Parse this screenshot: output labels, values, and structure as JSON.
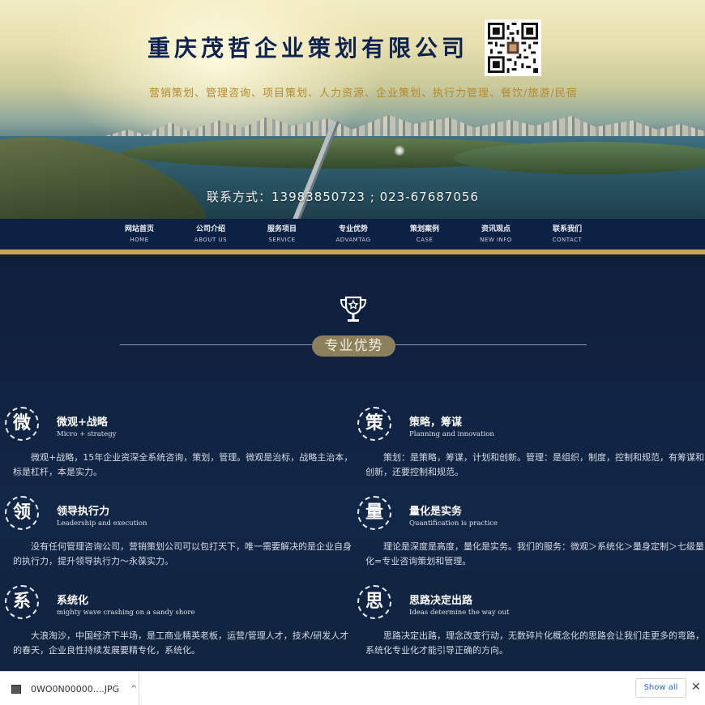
{
  "banner": {
    "company_title": "重庆茂哲企业策划有限公司",
    "services": "营销策划、管理咨询、项目策划、人力资源、企业策划、执行力管理、餐饮/旅游/民宿",
    "contact": "联系方式：13983850723 ; 023-67687056"
  },
  "nav": {
    "items": [
      {
        "cn": "网站首页",
        "en": "HOME"
      },
      {
        "cn": "公司介绍",
        "en": "ABOUT US"
      },
      {
        "cn": "服务项目",
        "en": "SERVICE"
      },
      {
        "cn": "专业优势",
        "en": "ADVAMTAG"
      },
      {
        "cn": "策划案例",
        "en": "CASE"
      },
      {
        "cn": "资讯观点",
        "en": "NEW INFO"
      },
      {
        "cn": "联系我们",
        "en": "CONTACT"
      }
    ]
  },
  "section": {
    "title": "专业优势",
    "icon": "trophy-icon"
  },
  "features": [
    {
      "char": "微",
      "title": "微观+战略",
      "subtitle": "Micro + strategy",
      "body": "微观+战略，15年企业资深全系统咨询，策划，管理。微观是治标，战略主治本，标是杠杆，本是实力。"
    },
    {
      "char": "策",
      "title": "策略，筹谋",
      "subtitle": "Planning and innovation",
      "body": "策划：是策略，筹谋，计划和创新。管理：是组织，制度，控制和规范，有筹谋和创新，还要控制和规范。"
    },
    {
      "char": "领",
      "title": "领导执行力",
      "subtitle": "Leadership and execution",
      "body": "没有任何管理咨询公司，营销策划公司可以包打天下，唯一需要解决的是企业自身的执行力，提升领导执行力～永葆实力。"
    },
    {
      "char": "量",
      "title": "量化是实务",
      "subtitle": "Quantification is practice",
      "body": "理论是深度是高度，量化是实务。我们的服务：微观＞系统化＞量身定制＞七级量化=专业咨询策划和管理。"
    },
    {
      "char": "系",
      "title": "系统化",
      "subtitle": "mighty wave crashing on a sandy shore",
      "body": "大浪淘沙，中国经济下半场，是工商业精英老板，运营/管理人才，技术/研发人才的春天，企业良性持续发展要精专化，系统化。"
    },
    {
      "char": "思",
      "title": "思路决定出路",
      "subtitle": "Ideas determine the way out",
      "body": "思路决定出路，理念改变行动，无数碎片化概念化的思路会让我们走更多的弯路，系统化专业化才能引导正确的方向。"
    }
  ],
  "download_bar": {
    "file_name": "0WO0N00000....JPG",
    "show_all": "Show all",
    "close": "✕",
    "chevron": "^"
  },
  "colors": {
    "nav_bg": "#0d2145",
    "gold": "#c9a455",
    "section_bg": "#0f2140",
    "badge": "#8b7f5c",
    "title_blue": "#0e2350",
    "services_gold": "#b5892a"
  }
}
